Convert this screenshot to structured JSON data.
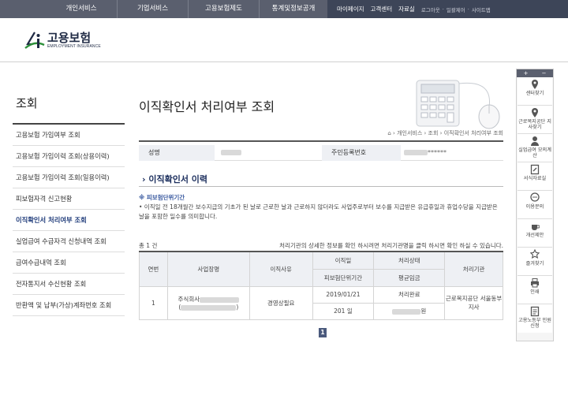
{
  "topnav": {
    "menu": [
      "개인서비스",
      "기업서비스",
      "고용보험제도",
      "통계및정보공개"
    ],
    "util": [
      "마이페이지",
      "고객센터",
      "자료실"
    ],
    "util_small": [
      "로그아웃",
      "·",
      "일괄제어",
      "·",
      "사이트맵"
    ]
  },
  "logo": {
    "title": "고용보험",
    "subtitle": "EMPLOYMENT INSURANCE"
  },
  "sidebar": {
    "title": "조회",
    "items": [
      "고용보험 가입여부 조회",
      "고용보험 가입이력 조회(상용이력)",
      "고용보험 가입이력 조회(일용이력)",
      "피보험자격 신고현황",
      "이직확인서 처리여부 조회",
      "실업급여 수급자격 신청내역 조회",
      "급여수급내역 조회",
      "전자통지서 수신현황 조회",
      "반환액 및 납부(가상)계좌번호 조회"
    ],
    "active_index": 4
  },
  "main": {
    "title": "이직확인서 처리여부 조회",
    "breadcrumb": [
      "개인서비스",
      "조회",
      "이직확인서 처리여부 조회"
    ],
    "info": {
      "name_label": "성명",
      "rrn_label": "주민등록번호",
      "rrn_suffix": "******"
    },
    "section_title": "이직확인서 이력",
    "note_head": "※ 피보험단위기간",
    "note_body": "• 이직일 전 18개월간 보수지급의 기초가 된 날로 근로한 날과 근로하지 않더라도 사업주로부터 보수를 지급받은 유급휴일과 휴업수당을 지급받은 날을 포함한 일수를 의미합니다.",
    "count": "총 1 건",
    "hint": "처리기관의 상세한 정보를 확인 하시려면 처리기관명을 클릭 하시면 확인 하실 수 있습니다.",
    "table": {
      "headers": {
        "no": "연번",
        "company": "사업장명",
        "reason": "이직사유",
        "leave_date": "이직일",
        "status": "처리상태",
        "agency": "처리기관",
        "insured_period": "피보험단위기간",
        "avg_wage": "평균임금"
      },
      "rows": [
        {
          "no": "1",
          "company_prefix": "주식회사",
          "company_paren_open": "(",
          "company_paren_close": ")",
          "reason": "경영상필요",
          "leave_date": "2019/01/21",
          "status": "처리완료",
          "agency": "근로복지공단 서울동부지사",
          "insured_period": "201 일",
          "avg_wage_suffix": "원"
        }
      ]
    },
    "pager": {
      "current": "1"
    }
  },
  "quick": {
    "top": [
      "+",
      "−"
    ],
    "items": [
      {
        "label": "센터찾기",
        "icon": "location-pin-icon"
      },
      {
        "label": "근로복지공단 지사찾기",
        "icon": "location-pin-icon"
      },
      {
        "label": "실업급여 모의계산",
        "icon": "person-icon"
      },
      {
        "label": "서식자료실",
        "icon": "document-edit-icon"
      },
      {
        "label": "이용문의",
        "icon": "chat-bubble-icon"
      },
      {
        "label": "개선제안",
        "icon": "coffee-cup-icon"
      },
      {
        "label": "즐겨찾기",
        "icon": "star-icon"
      },
      {
        "label": "인쇄",
        "icon": "printer-icon"
      },
      {
        "label": "고용노동부 민원신청",
        "icon": "form-icon"
      }
    ]
  },
  "colors": {
    "nav": "#5a5f6e",
    "util": "#3d4558",
    "accent": "#1a2d5c",
    "link": "#3a5aa0"
  }
}
